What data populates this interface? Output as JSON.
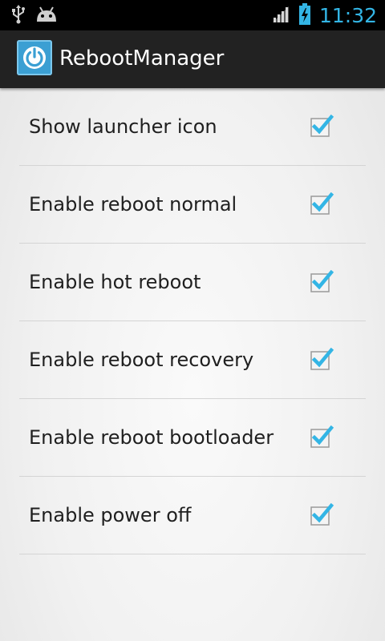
{
  "status_bar": {
    "time": "11:32",
    "icons": [
      "usb-icon",
      "android-icon",
      "signal-icon",
      "battery-charging-icon"
    ],
    "accent_color": "#33b5e5"
  },
  "action_bar": {
    "title": "RebootManager",
    "icon": "power-icon"
  },
  "settings": [
    {
      "label": "Show launcher icon",
      "checked": true
    },
    {
      "label": "Enable reboot normal",
      "checked": true
    },
    {
      "label": "Enable hot reboot",
      "checked": true
    },
    {
      "label": "Enable reboot recovery",
      "checked": true
    },
    {
      "label": "Enable reboot bootloader",
      "checked": true
    },
    {
      "label": "Enable power off",
      "checked": true
    }
  ],
  "colors": {
    "checkmark": "#33b5e5",
    "action_bar_bg": "#222222",
    "app_icon_bg": "#3b9fd3"
  }
}
